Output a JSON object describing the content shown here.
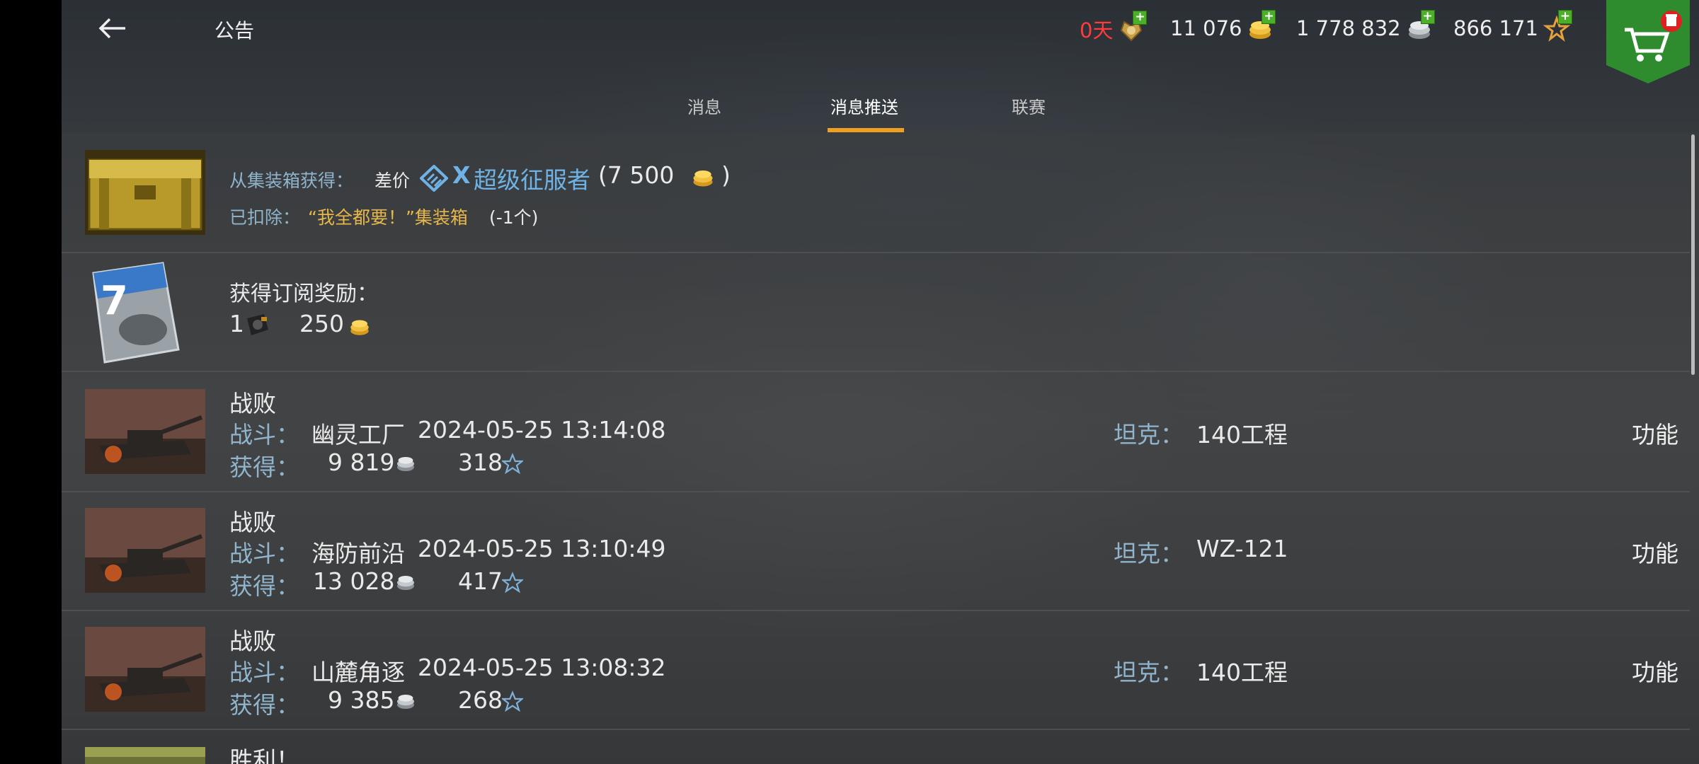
{
  "header": {
    "title": "公告",
    "days": "0天",
    "gold": "11 076",
    "silver": "1 778 832",
    "free_xp": "866 171"
  },
  "tabs": [
    {
      "label": "消息"
    },
    {
      "label": "消息推送"
    },
    {
      "label": "联赛"
    }
  ],
  "active_tab": 1,
  "messages": [
    {
      "line1_label": "从集装箱获得：",
      "line1_kind": "差价",
      "tier": "X",
      "tank_name": "超级征服者",
      "amount_prefix": "(7 500",
      "amount_suffix": ")",
      "line2_label": "已扣除：",
      "line2_item": "“我全都要！”集装箱",
      "line2_qty": "(-1个)"
    },
    {
      "title": "获得订阅奖励：",
      "qty_label": "1",
      "gold": "250",
      "thumb_number": "7"
    },
    {
      "result": "战败",
      "battle_label": "战斗：",
      "map": "幽灵工厂",
      "datetime": "2024-05-25 13:14:08",
      "earn_label": "获得：",
      "credits": "9 819",
      "xp": "318",
      "tank_label": "坦克：",
      "tank": "140工程",
      "func": "功能"
    },
    {
      "result": "战败",
      "battle_label": "战斗：",
      "map": "海防前沿",
      "datetime": "2024-05-25 13:10:49",
      "earn_label": "获得：",
      "credits": "13 028",
      "xp": "417",
      "tank_label": "坦克：",
      "tank": "WZ-121",
      "func": "功能"
    },
    {
      "result": "战败",
      "battle_label": "战斗：",
      "map": "山麓角逐",
      "datetime": "2024-05-25 13:08:32",
      "earn_label": "获得：",
      "credits": "9 385",
      "xp": "268",
      "tank_label": "坦克：",
      "tank": "140工程",
      "func": "功能"
    },
    {
      "result": "胜利！"
    }
  ],
  "colors": {
    "accent": "#f0a020",
    "label_blue": "#8fb4cc",
    "gold_text": "#e6b74a",
    "days_red": "#ff3b3b",
    "shop_green": "#2e8b2e"
  }
}
